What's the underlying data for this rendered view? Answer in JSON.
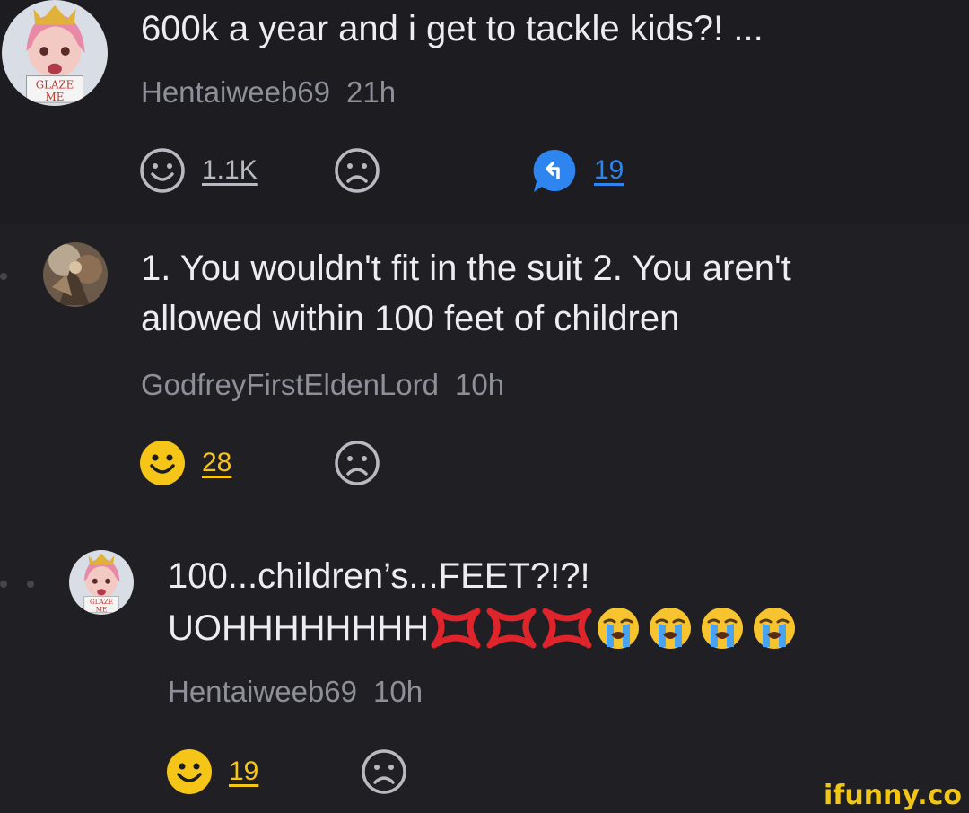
{
  "post": {
    "title": "600k a year and i get to tackle kids?! ...",
    "author": "Hentaiweeb69",
    "time": "21h",
    "smile_count": "1.1K",
    "reply_count": "19",
    "avatar_text": "GLAZE ME"
  },
  "comments": [
    {
      "line1": "1. You wouldn't fit in the suit 2. You aren't",
      "line2": "allowed within 100 feet of children",
      "author": "GodfreyFirstEldenLord",
      "time": "10h",
      "smile_count": "28"
    },
    {
      "line1": "100...children’s...FEET?!?!",
      "line2": "UOHHHHHHHH",
      "author": "Hentaiweeb69",
      "time": "10h",
      "smile_count": "19",
      "avatar_text": "GLAZE ME"
    }
  ],
  "watermark": "ifunny.co",
  "colors": {
    "background": "#1c1c21",
    "accent_yellow": "#f5c518",
    "accent_blue": "#2e85f0",
    "text_muted": "#8f8f99"
  },
  "icons": [
    "smile-outline-icon",
    "frown-icon",
    "reply-bubble-icon",
    "smile-filled-icon",
    "anger-emoji",
    "crying-emoji"
  ]
}
